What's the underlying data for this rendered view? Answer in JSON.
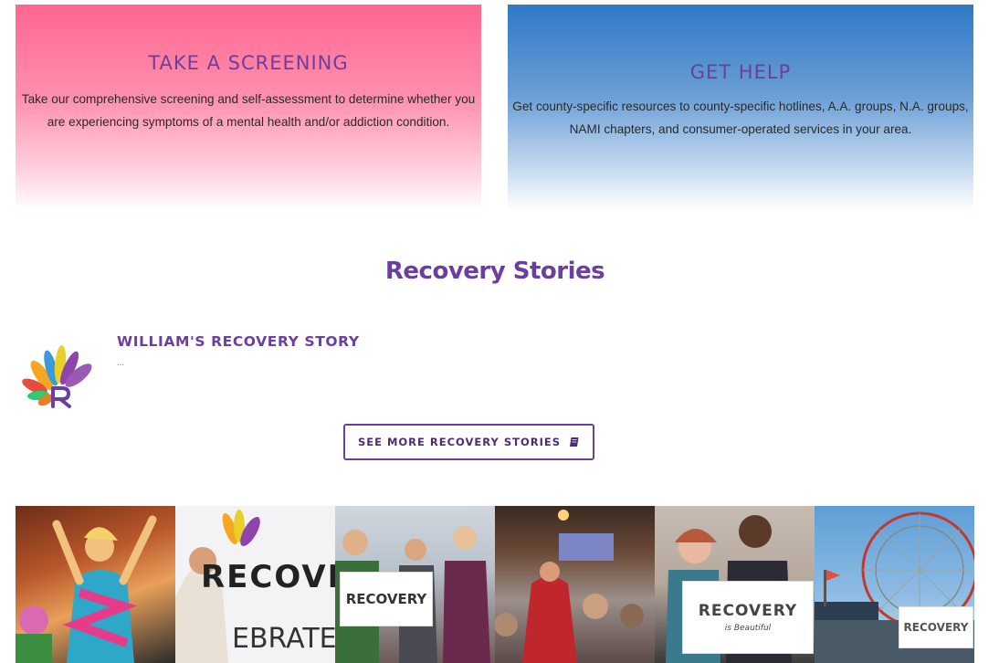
{
  "screening": {
    "title": "TAKE A SCREENING",
    "text": "Take our comprehensive screening and self-assessment to determine whether you are experiencing symptoms of a mental health and/or addiction condition."
  },
  "get_help": {
    "title": "GET HELP",
    "text": "Get county-specific resources to county-specific hotlines, A.A. groups, N.A. groups, NAMI chapters, and consumer-operated services in your area."
  },
  "recovery_stories": {
    "heading": "Recovery Stories",
    "story": {
      "title": "WILLIAM'S RECOVERY STORY",
      "excerpt": "..."
    },
    "more_button": {
      "label": "SEE MORE RECOVERY STORIES",
      "icon": "book-icon"
    }
  },
  "gallery": {
    "photos": [
      {
        "name": "photo-celebration-stage"
      },
      {
        "name": "photo-celebrate-banner",
        "sign_text": "EBRATE",
        "logo_text": "RECOVE"
      },
      {
        "name": "photo-recovery-sign-group",
        "sign_text": "RECOVERY"
      },
      {
        "name": "photo-conference-crowd"
      },
      {
        "name": "photo-recovery-sign-pair",
        "sign_text": "RECOVERY",
        "sign_sub": "is Beautiful"
      },
      {
        "name": "photo-ferris-wheel",
        "sign_text": "RECOVERY"
      }
    ]
  },
  "colors": {
    "brand_purple": "#6b3fa0",
    "pink": "#ff6690",
    "blue": "#2f79c6"
  }
}
